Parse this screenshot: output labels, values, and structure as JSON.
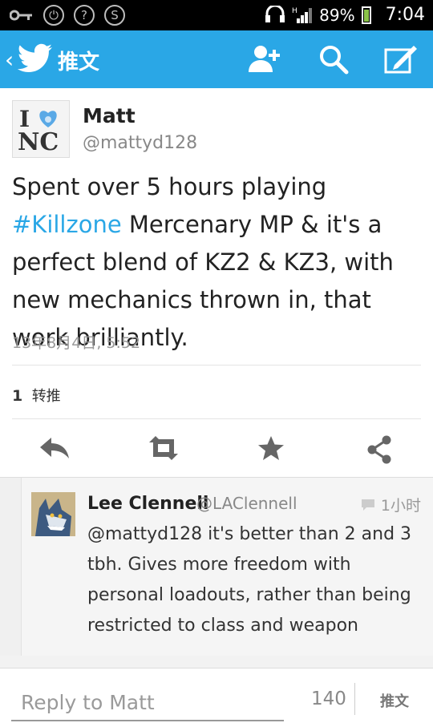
{
  "status_bar": {
    "battery": "89%",
    "time": "7:04",
    "network": "H"
  },
  "app_bar": {
    "title": "推文"
  },
  "tweet": {
    "name": "Matt",
    "handle": "@mattyd128",
    "text_before": "Spent over 5 hours playing ",
    "hashtag": "#Killzone",
    "text_after": " Mercenary MP & it's a perfect blend of KZ2 & KZ3, with new mechanics thrown in, that work brilliantly.",
    "timestamp": "13年8月4日, 5:52",
    "retweet_count": "1",
    "retweet_label": "转推",
    "avatar_text": {
      "top": "I",
      "bottom": "NC"
    }
  },
  "reply": {
    "name": "Lee Clennell",
    "handle": "@LAClennell",
    "time": "1小时",
    "text": "@mattyd128 it's better than 2 and 3 tbh. Gives more freedom with personal loadouts, rather than being restricted to class and weapon"
  },
  "composer": {
    "placeholder": "Reply to Matt",
    "char_count": "140",
    "send_label": "推文"
  },
  "colors": {
    "accent": "#2aa7e6",
    "hashtag": "#2aa7e6",
    "icon_gray": "#666666"
  },
  "icons": [
    "key-icon",
    "power-icon",
    "wifi-unknown-icon",
    "sync-icon",
    "headset-icon",
    "signal-icon",
    "battery-icon",
    "back-chevron-icon",
    "twitter-bird-icon",
    "add-user-icon",
    "search-icon",
    "compose-icon",
    "reply-icon",
    "retweet-icon",
    "favorite-star-icon",
    "share-icon",
    "comment-bubble-icon"
  ]
}
